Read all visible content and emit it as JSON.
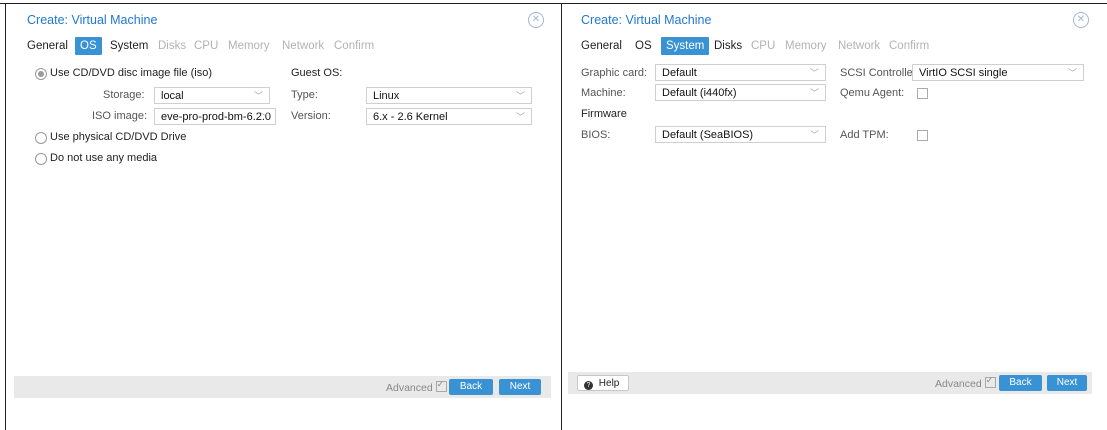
{
  "left": {
    "title": "Create: Virtual Machine",
    "tabs": [
      {
        "label": "General",
        "state": "enabled"
      },
      {
        "label": "OS",
        "state": "active"
      },
      {
        "label": "System",
        "state": "enabled"
      },
      {
        "label": "Disks",
        "state": "disabled"
      },
      {
        "label": "CPU",
        "state": "disabled"
      },
      {
        "label": "Memory",
        "state": "disabled"
      },
      {
        "label": "Network",
        "state": "disabled"
      },
      {
        "label": "Confirm",
        "state": "disabled"
      }
    ],
    "radio_iso": "Use CD/DVD disc image file (iso)",
    "storage_label": "Storage:",
    "storage_value": "local",
    "iso_label": "ISO image:",
    "iso_value": "eve-pro-prod-bm-6.2.0",
    "radio_physical": "Use physical CD/DVD Drive",
    "radio_none": "Do not use any media",
    "guest_os_label": "Guest OS:",
    "type_label": "Type:",
    "type_value": "Linux",
    "version_label": "Version:",
    "version_value": "6.x - 2.6 Kernel",
    "advanced_label": "Advanced",
    "back_label": "Back",
    "next_label": "Next"
  },
  "right": {
    "title": "Create: Virtual Machine",
    "tabs": [
      {
        "label": "General",
        "state": "enabled"
      },
      {
        "label": "OS",
        "state": "enabled"
      },
      {
        "label": "System",
        "state": "active"
      },
      {
        "label": "Disks",
        "state": "enabled"
      },
      {
        "label": "CPU",
        "state": "disabled"
      },
      {
        "label": "Memory",
        "state": "disabled"
      },
      {
        "label": "Network",
        "state": "disabled"
      },
      {
        "label": "Confirm",
        "state": "disabled"
      }
    ],
    "graphic_label": "Graphic card:",
    "graphic_value": "Default",
    "machine_label": "Machine:",
    "machine_value": "Default (i440fx)",
    "firmware_label": "Firmware",
    "bios_label": "BIOS:",
    "bios_value": "Default (SeaBIOS)",
    "scsi_label": "SCSI Controller:",
    "scsi_value": "VirtIO SCSI single",
    "qemu_label": "Qemu Agent:",
    "tpm_label": "Add TPM:",
    "help_label": "Help",
    "advanced_label": "Advanced",
    "back_label": "Back",
    "next_label": "Next"
  },
  "icons": {
    "close": "close-circle-icon",
    "chevron": "chevron-down-icon",
    "help": "question-circle-icon",
    "checkbox": "checkbox-icon"
  },
  "colors": {
    "accent": "#3892d4",
    "title": "#1f78d1",
    "footer": "#e9e9e9",
    "disabled_tab": "#b3b3b3"
  }
}
